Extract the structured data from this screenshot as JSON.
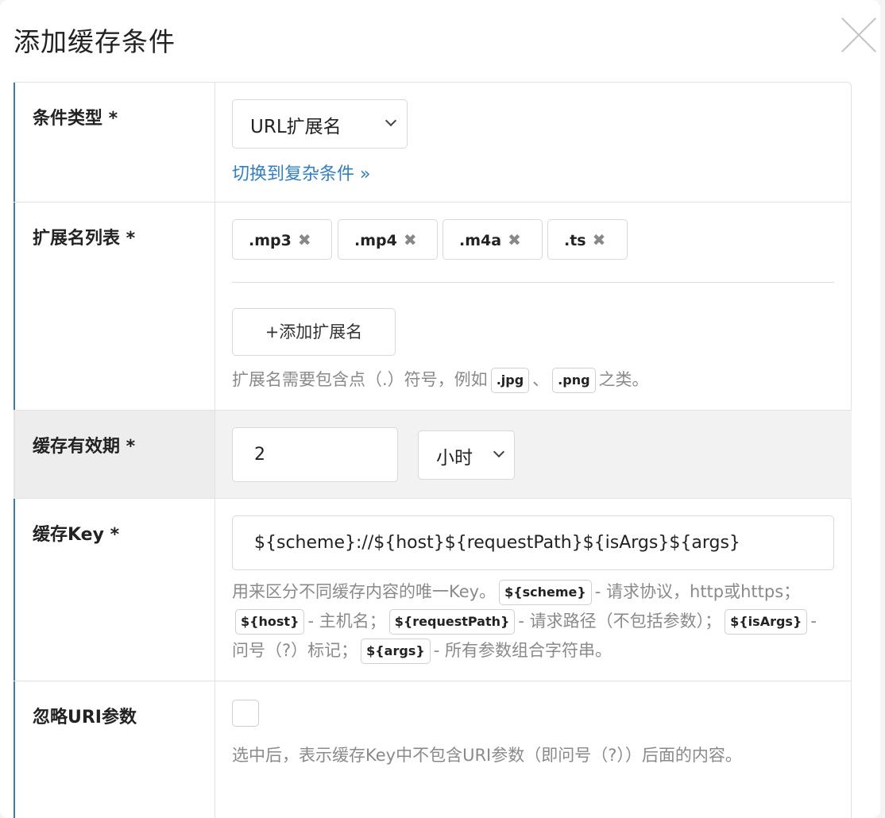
{
  "dialog": {
    "title": "添加缓存条件"
  },
  "condition_type": {
    "label": "条件类型 *",
    "selected": "URL扩展名",
    "switch_link": "切换到复杂条件 »"
  },
  "extensions": {
    "label": "扩展名列表 *",
    "tags": [
      ".mp3",
      ".mp4",
      ".m4a",
      ".ts"
    ],
    "remove_glyph": "✖",
    "add_button": "+添加扩展名",
    "help": {
      "prefix": "扩展名需要包含点（.）符号，例如",
      "ex1": ".jpg",
      "sep": "、",
      "ex2": ".png",
      "suffix": "之类。"
    }
  },
  "ttl": {
    "label": "缓存有效期 *",
    "value": "2",
    "unit": "小时"
  },
  "cache_key": {
    "label": "缓存Key *",
    "value": "${scheme}://${host}${requestPath}${isArgs}${args}",
    "help": {
      "t1": "用来区分不同缓存内容的唯一Key。",
      "c1": "${scheme}",
      "t2": "- 请求协议，http或https；",
      "c2": "${host}",
      "t3": "- 主机名；",
      "c3": "${requestPath}",
      "t4": "- 请求路径（不包括参数）；",
      "c4": "${isArgs}",
      "t5": "- 问号（?）标记；",
      "c5": "${args}",
      "t6": "- 所有参数组合字符串。"
    }
  },
  "ignore_uri_args": {
    "label": "忽略URI参数",
    "checked": false,
    "help": "选中后，表示缓存Key中不包含URI参数（即问号（?））后面的内容。"
  },
  "colors": {
    "accent": "#2f7fc8",
    "help_text": "#8a8a8a",
    "border": "#e2e2e2"
  }
}
